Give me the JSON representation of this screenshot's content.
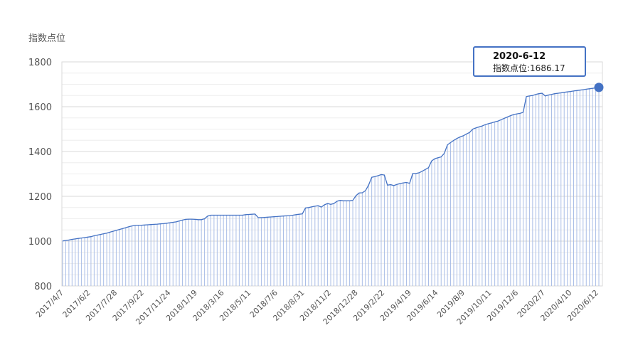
{
  "chart_data": {
    "type": "area",
    "ylabel": "指数点位",
    "ylim": [
      800,
      1800
    ],
    "yticks": [
      800,
      1000,
      1200,
      1400,
      1600,
      1800
    ],
    "grid": true,
    "xtick_labels": [
      "2017/4/7",
      "2017/6/2",
      "2017/7/28",
      "2017/9/22",
      "2017/11/24",
      "2018/1/19",
      "2018/3/16",
      "2018/5/11",
      "2018/7/6",
      "2018/8/31",
      "2018/11/2",
      "2018/12/28",
      "2019/2/22",
      "2019/4/19",
      "2019/6/14",
      "2019/8/9",
      "2019/10/11",
      "2019/12/6",
      "2020/2/7",
      "2020/4/10",
      "2020/6/12"
    ],
    "series": [
      {
        "color": "#4472c4",
        "values": [
          1001,
          1003,
          1005,
          1008,
          1010,
          1012,
          1014,
          1016,
          1018,
          1020,
          1024,
          1027,
          1030,
          1033,
          1036,
          1040,
          1044,
          1048,
          1052,
          1056,
          1060,
          1064,
          1068,
          1070,
          1071,
          1071,
          1072,
          1073,
          1074,
          1075,
          1076,
          1077,
          1078,
          1080,
          1082,
          1084,
          1086,
          1090,
          1094,
          1097,
          1098,
          1098,
          1097,
          1096,
          1096,
          1100,
          1112,
          1116,
          1116,
          1116,
          1116,
          1116,
          1116,
          1116,
          1116,
          1116,
          1116,
          1116,
          1118,
          1119,
          1120,
          1121,
          1105,
          1105,
          1106,
          1107,
          1108,
          1109,
          1110,
          1111,
          1112,
          1113,
          1114,
          1116,
          1118,
          1120,
          1122,
          1148,
          1150,
          1153,
          1156,
          1158,
          1152,
          1162,
          1168,
          1164,
          1168,
          1178,
          1182,
          1180,
          1180,
          1180,
          1182,
          1203,
          1215,
          1216,
          1225,
          1250,
          1285,
          1288,
          1292,
          1297,
          1295,
          1250,
          1252,
          1248,
          1253,
          1257,
          1260,
          1262,
          1258,
          1302,
          1302,
          1305,
          1312,
          1320,
          1328,
          1358,
          1368,
          1372,
          1376,
          1392,
          1430,
          1440,
          1450,
          1458,
          1465,
          1470,
          1478,
          1485,
          1500,
          1505,
          1510,
          1514,
          1520,
          1524,
          1528,
          1532,
          1536,
          1542,
          1548,
          1554,
          1560,
          1565,
          1568,
          1570,
          1575,
          1645,
          1648,
          1650,
          1655,
          1658,
          1660,
          1648,
          1652,
          1655,
          1658,
          1660,
          1662,
          1664,
          1666,
          1668,
          1670,
          1672,
          1674,
          1676,
          1678,
          1680,
          1682,
          1684,
          1686.17
        ]
      }
    ],
    "highlight": {
      "date": "2020-6-12",
      "label": "指数点位:1686.17",
      "value": 1686.17
    }
  }
}
